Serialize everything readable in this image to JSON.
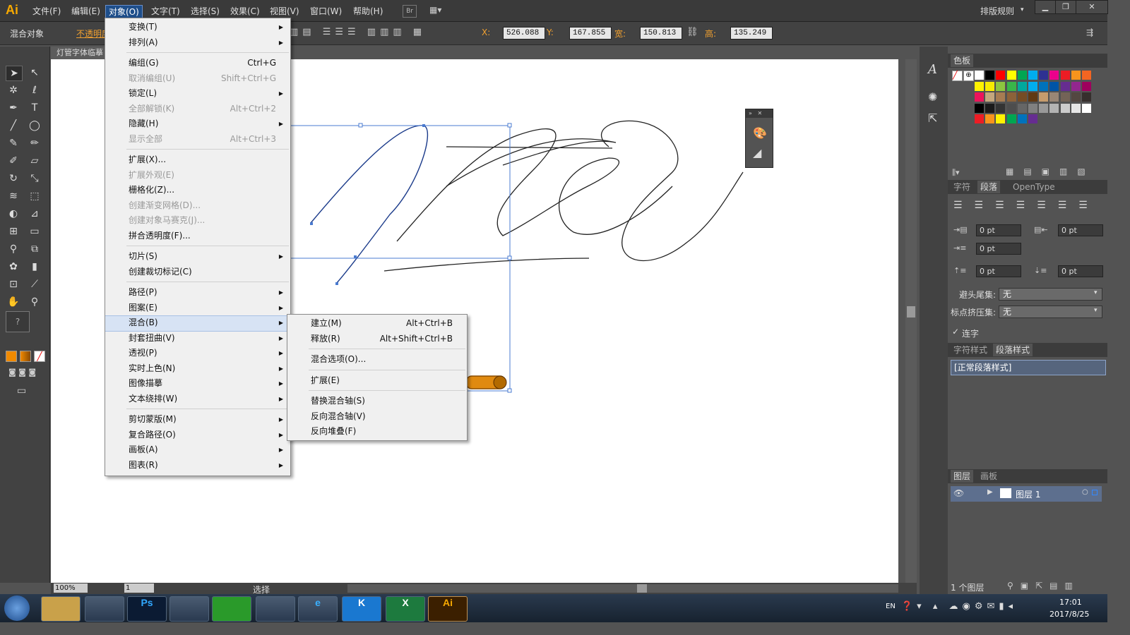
{
  "app": {
    "logo": "Ai",
    "workspace": "排版规则"
  },
  "menubar": [
    "文件(F)",
    "编辑(E)",
    "对象(O)",
    "文字(T)",
    "选择(S)",
    "效果(C)",
    "视图(V)",
    "窗口(W)",
    "帮助(H)"
  ],
  "menubar_extra": {
    "br": "Br"
  },
  "control": {
    "selection_label": "混合对象",
    "opacity_label": "不透明度",
    "x_label": "X:",
    "x": "526.088",
    "y_label": "Y:",
    "y": "167.855",
    "w_label": "宽:",
    "w": "150.813",
    "h_label": "高:",
    "h": "135.249"
  },
  "document": {
    "tab": "灯管字体临摹",
    "zoom": "100%",
    "page": "1",
    "status": "选择"
  },
  "object_menu": [
    {
      "label": "变换(T)",
      "arrow": true
    },
    {
      "label": "排列(A)",
      "arrow": true
    },
    {
      "sep": true
    },
    {
      "label": "编组(G)",
      "shortcut": "Ctrl+G"
    },
    {
      "label": "取消编组(U)",
      "shortcut": "Shift+Ctrl+G",
      "disabled": true
    },
    {
      "label": "锁定(L)",
      "arrow": true
    },
    {
      "label": "全部解锁(K)",
      "shortcut": "Alt+Ctrl+2",
      "disabled": true
    },
    {
      "label": "隐藏(H)",
      "arrow": true
    },
    {
      "label": "显示全部",
      "shortcut": "Alt+Ctrl+3",
      "disabled": true
    },
    {
      "sep": true
    },
    {
      "label": "扩展(X)..."
    },
    {
      "label": "扩展外观(E)",
      "disabled": true
    },
    {
      "label": "栅格化(Z)..."
    },
    {
      "label": "创建渐变网格(D)...",
      "disabled": true
    },
    {
      "label": "创建对象马赛克(J)...",
      "disabled": true
    },
    {
      "label": "拼合透明度(F)..."
    },
    {
      "sep": true
    },
    {
      "label": "切片(S)",
      "arrow": true
    },
    {
      "label": "创建裁切标记(C)"
    },
    {
      "sep": true
    },
    {
      "label": "路径(P)",
      "arrow": true
    },
    {
      "label": "图案(E)",
      "arrow": true
    },
    {
      "label": "混合(B)",
      "arrow": true,
      "highlight": true
    },
    {
      "label": "封套扭曲(V)",
      "arrow": true
    },
    {
      "label": "透视(P)",
      "arrow": true
    },
    {
      "label": "实时上色(N)",
      "arrow": true
    },
    {
      "label": "图像描摹",
      "arrow": true
    },
    {
      "label": "文本绕排(W)",
      "arrow": true
    },
    {
      "sep": true
    },
    {
      "label": "剪切蒙版(M)",
      "arrow": true
    },
    {
      "label": "复合路径(O)",
      "arrow": true
    },
    {
      "label": "画板(A)",
      "arrow": true
    },
    {
      "label": "图表(R)",
      "arrow": true
    }
  ],
  "blend_menu": [
    {
      "label": "建立(M)",
      "shortcut": "Alt+Ctrl+B"
    },
    {
      "label": "释放(R)",
      "shortcut": "Alt+Shift+Ctrl+B"
    },
    {
      "sep": true
    },
    {
      "label": "混合选项(O)..."
    },
    {
      "sep": true
    },
    {
      "label": "扩展(E)"
    },
    {
      "sep": true
    },
    {
      "label": "替换混合轴(S)"
    },
    {
      "label": "反向混合轴(V)"
    },
    {
      "label": "反向堆叠(F)"
    }
  ],
  "swatches_panel": {
    "title": "色板",
    "colors": [
      "#ffffff",
      "#000000",
      "#ff0000",
      "#ffff00",
      "#00a651",
      "#00aeef",
      "#2e3192",
      "#ec008c",
      "#ed1c24",
      "#f7941d",
      "#f26522",
      "#fff200",
      "#f7ec00",
      "#8dc63f",
      "#39b54a",
      "#00a99d",
      "#00aeef",
      "#0072bc",
      "#0054a6",
      "#662d91",
      "#92278f",
      "#9e005d",
      "#ed145b",
      "#c4a77d",
      "#a67c52",
      "#8c6239",
      "#754c24",
      "#603913",
      "#c69c6d",
      "#998675",
      "#736357",
      "#534741",
      "#362f2d",
      "#000000",
      "#1a1a1a",
      "#333333",
      "#4d4d4d",
      "#666666",
      "#808080",
      "#999999",
      "#b3b3b3",
      "#cccccc",
      "#e6e6e6",
      "#ffffff",
      "#ed1c24",
      "#f7941d",
      "#fff200",
      "#00a651",
      "#0072bc",
      "#662d91"
    ]
  },
  "paragraph_panel": {
    "tabs": [
      "字符",
      "段落",
      "OpenType"
    ],
    "left_indent": "0 pt",
    "right_indent": "0 pt",
    "first_line_indent": "0 pt",
    "space_before": "0 pt",
    "space_after": "0 pt",
    "kinsoku_label": "避头尾集:",
    "kinsoku": "无",
    "mojikumi_label": "标点挤压集:",
    "mojikumi": "无",
    "hyphenate_label": "连字"
  },
  "style_panel": {
    "tabs": [
      "字符样式",
      "段落样式"
    ],
    "item": "[正常段落样式]"
  },
  "layers_panel": {
    "tabs": [
      "图层",
      "画板"
    ],
    "layer": "图层 1",
    "count": "1 个图层"
  },
  "taskbar": {
    "lang": "EN",
    "time": "17:01",
    "date": "2017/8/25",
    "apps": [
      "",
      "",
      "Ps",
      "",
      "",
      "",
      "e",
      "K",
      "X",
      "Ai"
    ]
  },
  "colors": {
    "accent_orange": "#f7a900",
    "selection_blue": "#4a7bd0",
    "menu_bg": "#f0f0f0"
  }
}
